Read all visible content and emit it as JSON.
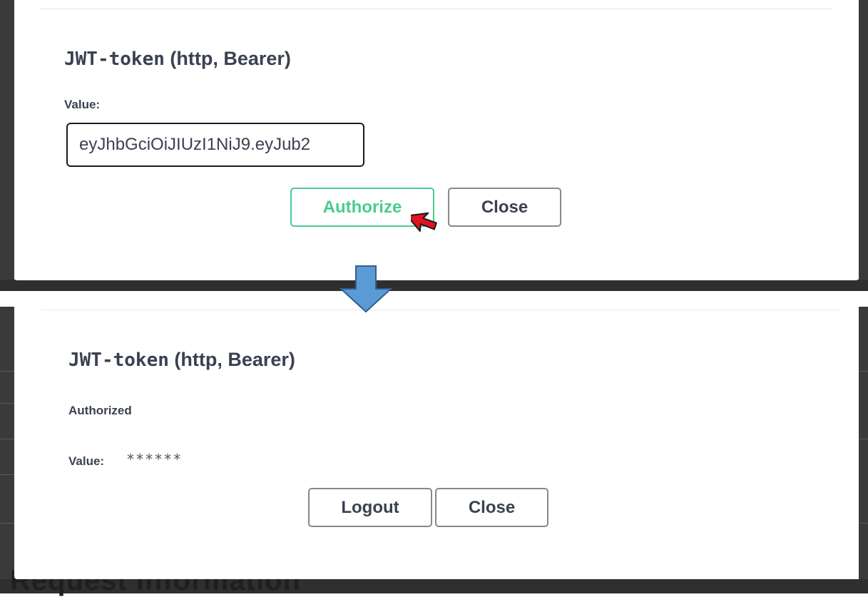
{
  "background": {
    "section_heading": "Request Information"
  },
  "before_dialog": {
    "scheme_name": "JWT-token",
    "scheme_type": "(http, Bearer)",
    "value_label": "Value:",
    "token_value": "eyJhbGciOiJIUzI1NiJ9.eyJub2",
    "authorize_label": "Authorize",
    "close_label": "Close"
  },
  "after_dialog": {
    "scheme_name": "JWT-token",
    "scheme_type": "(http, Bearer)",
    "status_text": "Authorized",
    "value_label": "Value:",
    "masked_value": "******",
    "logout_label": "Logout",
    "close_label": "Close"
  },
  "colors": {
    "authorize_accent": "#49cc90",
    "arrow_fill": "#5b9bd5",
    "cursor_fill": "#e0141e"
  },
  "icons": {
    "cursor": "mouse-pointer-icon",
    "transition": "arrow-down-icon"
  }
}
